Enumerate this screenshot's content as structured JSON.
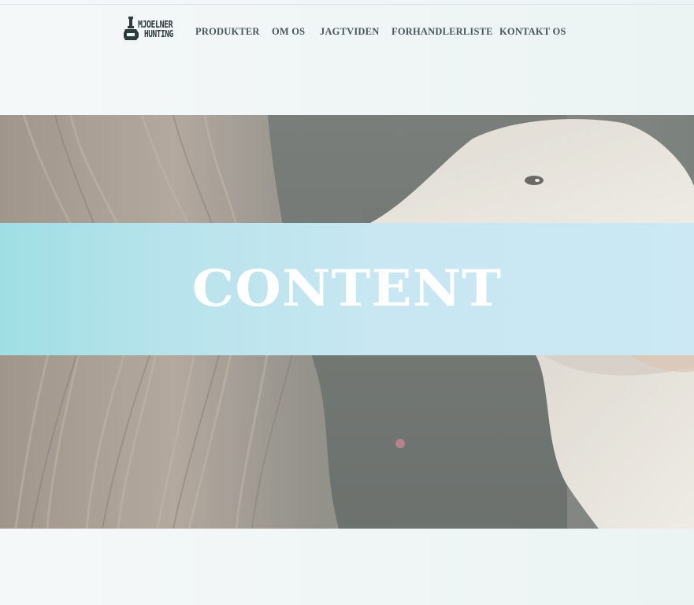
{
  "brand": {
    "name_line1": "MJOELNER",
    "name_line2": "HUNTING",
    "icon": "hammer-logo-icon"
  },
  "nav": {
    "items": [
      {
        "label": "PRODUKTER"
      },
      {
        "label": "OM OS"
      },
      {
        "label": "JAGTVIDEN"
      },
      {
        "label": "FORHANDLERLISTE"
      },
      {
        "label": "KONTAKT OS"
      }
    ]
  },
  "hero": {
    "title": "CONTENT",
    "band_color_start": "#9fdfe4",
    "band_color_end": "#cbe8f4"
  },
  "colors": {
    "nav_text": "#4a5657",
    "logo_text": "#2e3a3b",
    "page_background": "#f1f6f6"
  }
}
